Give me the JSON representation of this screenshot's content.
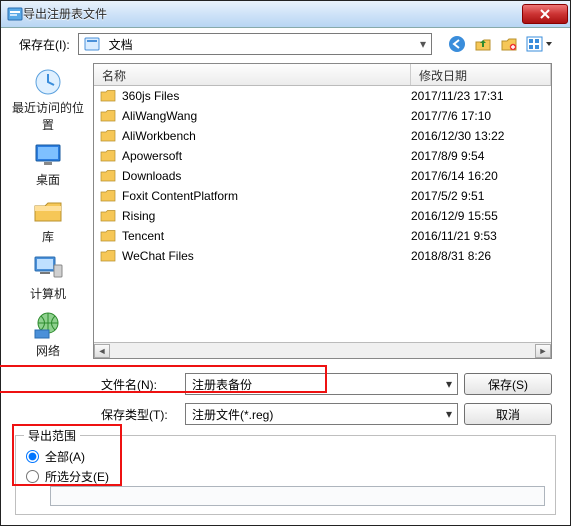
{
  "colors": {
    "accent": "#3a8ddb",
    "danger": "#c33322",
    "folder": "#f6c757",
    "highlight": "#e11"
  },
  "titlebar": {
    "title": "导出注册表文件",
    "close_icon": "close"
  },
  "toolbar": {
    "save_in_label": "保存在(I):",
    "location": "文档",
    "icons": {
      "back": "back-icon",
      "up": "up-icon",
      "new_folder": "new-folder-icon",
      "view": "view-menu-icon"
    }
  },
  "places": [
    {
      "id": "recent",
      "label": "最近访问的位置"
    },
    {
      "id": "desktop",
      "label": "桌面"
    },
    {
      "id": "libraries",
      "label": "库"
    },
    {
      "id": "computer",
      "label": "计算机"
    },
    {
      "id": "network",
      "label": "网络"
    }
  ],
  "file_pane": {
    "columns": {
      "name": "名称",
      "date": "修改日期"
    },
    "items": [
      {
        "name": "360js Files",
        "date": "2017/11/23 17:31"
      },
      {
        "name": "AliWangWang",
        "date": "2017/7/6 17:10"
      },
      {
        "name": "AliWorkbench",
        "date": "2016/12/30 13:22"
      },
      {
        "name": "Apowersoft",
        "date": "2017/8/9 9:54"
      },
      {
        "name": "Downloads",
        "date": "2017/6/14 16:20"
      },
      {
        "name": "Foxit ContentPlatform",
        "date": "2017/5/2 9:51"
      },
      {
        "name": "Rising",
        "date": "2016/12/9 15:55"
      },
      {
        "name": "Tencent",
        "date": "2016/11/21 9:53"
      },
      {
        "name": "WeChat Files",
        "date": "2018/8/31 8:26"
      }
    ]
  },
  "inputs": {
    "filename_label": "文件名(N):",
    "filename_value": "注册表备份",
    "filetype_label": "保存类型(T):",
    "filetype_value": "注册文件(*.reg)",
    "save_button": "保存(S)",
    "cancel_button": "取消"
  },
  "range": {
    "legend": "导出范围",
    "all_label": "全部(A)",
    "selected_branch_label": "所选分支(E)",
    "selected": "all",
    "branch_path": ""
  }
}
